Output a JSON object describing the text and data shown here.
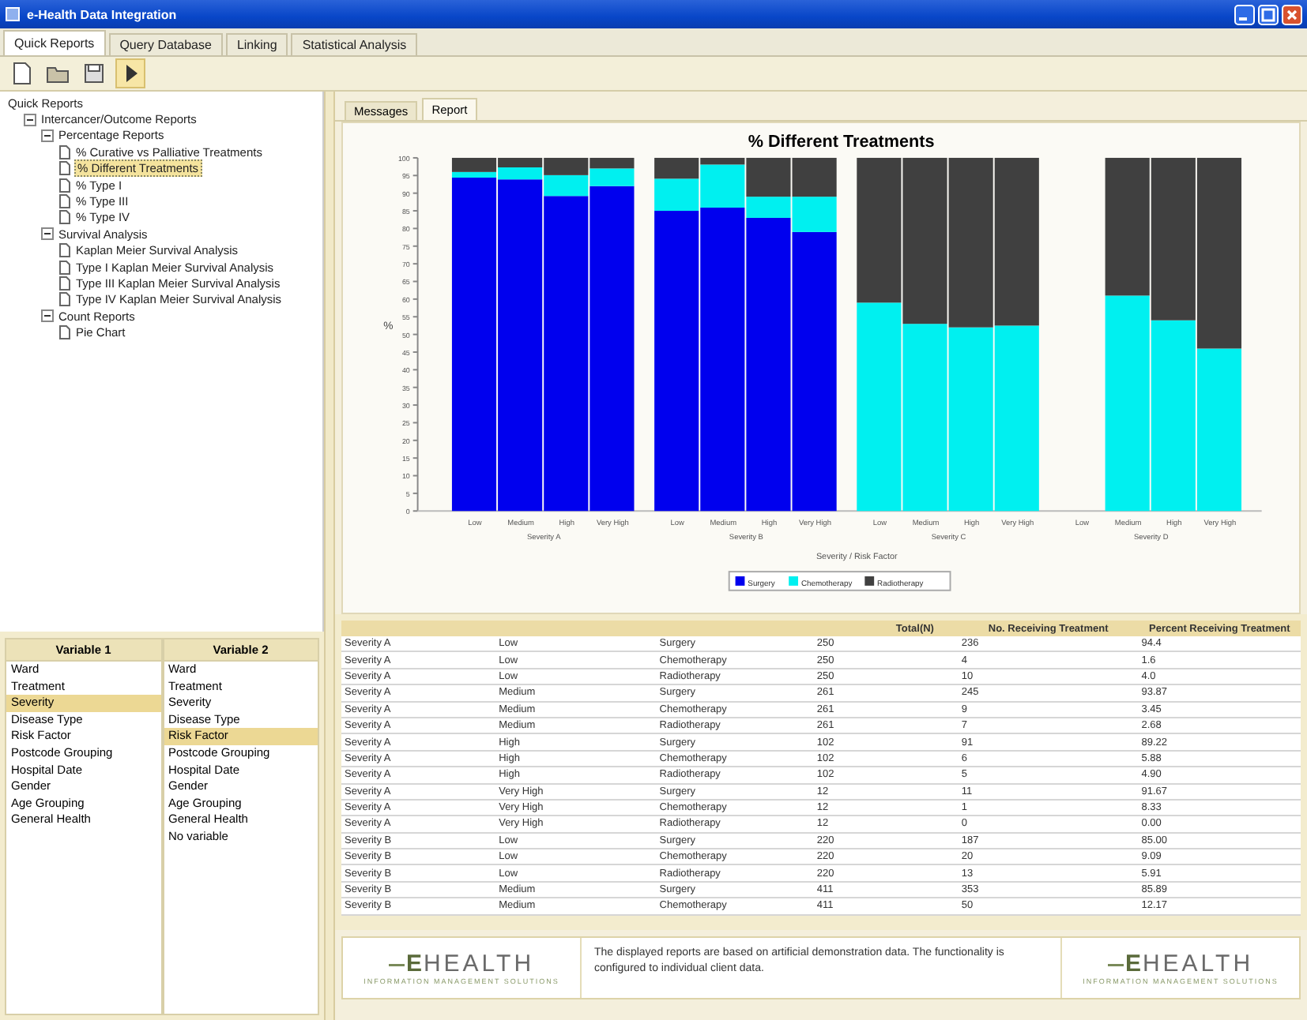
{
  "window": {
    "title": "e-Health Data Integration"
  },
  "menu_tabs": [
    {
      "label": "Quick Reports",
      "selected": true
    },
    {
      "label": "Query Database",
      "selected": false
    },
    {
      "label": "Linking",
      "selected": false
    },
    {
      "label": "Statistical Analysis",
      "selected": false
    }
  ],
  "toolbar": [
    {
      "kind": "document"
    },
    {
      "kind": "folder"
    },
    {
      "kind": "disk"
    },
    {
      "kind": "play"
    }
  ],
  "tree": {
    "items": [
      {
        "label": "Quick Reports",
        "kind": "root",
        "children": [
          {
            "label": "Intercancer/Outcome Reports",
            "kind": "folder",
            "expanded": true,
            "children": [
              {
                "label": "Percentage Reports",
                "kind": "folder",
                "expanded": true,
                "children": [
                  {
                    "label": "% Curative vs Palliative Treatments",
                    "kind": "report",
                    "selected": false
                  },
                  {
                    "label": "% Different Treatments",
                    "kind": "report",
                    "selected": true
                  },
                  {
                    "label": "% Type I",
                    "kind": "report",
                    "selected": false
                  },
                  {
                    "label": "% Type III",
                    "kind": "report",
                    "selected": false
                  },
                  {
                    "label": "% Type IV",
                    "kind": "report",
                    "selected": false
                  }
                ]
              },
              {
                "label": "Survival Analysis",
                "kind": "folder",
                "expanded": true,
                "children": [
                  {
                    "label": "Kaplan Meier Survival Analysis",
                    "kind": "report",
                    "selected": false
                  },
                  {
                    "label": "Type I Kaplan Meier Survival Analysis",
                    "kind": "report",
                    "selected": false
                  },
                  {
                    "label": "Type III Kaplan Meier Survival Analysis",
                    "kind": "report",
                    "selected": false
                  },
                  {
                    "label": "Type IV Kaplan Meier Survival Analysis",
                    "kind": "report",
                    "selected": false
                  }
                ]
              },
              {
                "label": "Count Reports",
                "kind": "folder",
                "expanded": true,
                "children": [
                  {
                    "label": "Pie Chart",
                    "kind": "report",
                    "selected": false
                  }
                ]
              }
            ]
          }
        ]
      }
    ]
  },
  "variable_lists": [
    {
      "heading": "Variable 1",
      "items": [
        {
          "label": "Ward",
          "selected": false
        },
        {
          "label": "Treatment",
          "selected": false
        },
        {
          "label": "Severity",
          "selected": true
        },
        {
          "label": "Disease Type",
          "selected": false
        },
        {
          "label": "Risk Factor",
          "selected": false
        },
        {
          "label": "Postcode Grouping",
          "selected": false
        },
        {
          "label": "Hospital Date",
          "selected": false
        },
        {
          "label": "Gender",
          "selected": false
        },
        {
          "label": "Age Grouping",
          "selected": false
        },
        {
          "label": "General Health",
          "selected": false
        }
      ]
    },
    {
      "heading": "Variable 2",
      "items": [
        {
          "label": "Ward",
          "selected": false
        },
        {
          "label": "Treatment",
          "selected": false
        },
        {
          "label": "Severity",
          "selected": false
        },
        {
          "label": "Disease Type",
          "selected": false
        },
        {
          "label": "Risk Factor",
          "selected": true
        },
        {
          "label": "Postcode Grouping",
          "selected": false
        },
        {
          "label": "Hospital Date",
          "selected": false
        },
        {
          "label": "Gender",
          "selected": false
        },
        {
          "label": "Age Grouping",
          "selected": false
        },
        {
          "label": "General Health",
          "selected": false
        },
        {
          "label": "No variable",
          "selected": false
        }
      ]
    }
  ],
  "report_tabs": [
    {
      "label": "Messages",
      "selected": false
    },
    {
      "label": "Report",
      "selected": true
    }
  ],
  "chart": {
    "group_labels": [
      "Severity A",
      "Severity B",
      "Severity C",
      "Severity D"
    ],
    "chart_data": {
      "type": "bar",
      "stacked": true,
      "title": "% Different Treatments",
      "xlabel": "Severity / Risk Factor",
      "ylabel": "%",
      "categories": [
        "Low",
        "Medium",
        "High",
        "Very High",
        "Low",
        "Medium",
        "High",
        "Very High",
        "Low",
        "Medium",
        "High",
        "Very High",
        "Low",
        "Medium",
        "High",
        "Very High"
      ],
      "ylim": [
        0,
        100
      ],
      "legend": "bottom",
      "yticks": [
        0,
        5,
        10,
        15,
        20,
        25,
        30,
        35,
        40,
        45,
        50,
        55,
        60,
        65,
        70,
        75,
        80,
        85,
        90,
        95,
        100
      ],
      "series": [
        {
          "name": "Surgery",
          "color": "#0000ee",
          "values": [
            94.4,
            93.9,
            89.2,
            92.0,
            85.0,
            85.9,
            83.0,
            79.0,
            0,
            0,
            0,
            0,
            null,
            0,
            0,
            0
          ]
        },
        {
          "name": "Chemotherapy",
          "color": "#00f0f0",
          "values": [
            1.6,
            3.4,
            5.9,
            5.0,
            9.1,
            12.2,
            6.0,
            10.0,
            59.0,
            53.0,
            52.0,
            52.5,
            null,
            61.0,
            54.0,
            46.0
          ]
        },
        {
          "name": "Radiotherapy",
          "color": "#404040",
          "values": [
            4.0,
            2.7,
            4.9,
            3.0,
            5.9,
            1.9,
            11.0,
            11.0,
            41.0,
            47.0,
            48.0,
            47.5,
            null,
            39.0,
            46.0,
            54.0
          ]
        }
      ]
    }
  },
  "table": {
    "column_headings": [
      "Total(N)",
      "No. Receiving Treatment",
      "Percent Receiving Treatment"
    ],
    "rows": [
      [
        "Severity A",
        "Low",
        "Surgery",
        "250",
        "236",
        "94.4"
      ],
      [
        "Severity A",
        "Low",
        "Chemotherapy",
        "250",
        "4",
        "1.6"
      ],
      [
        "Severity A",
        "Low",
        "Radiotherapy",
        "250",
        "10",
        "4.0"
      ],
      [
        "Severity A",
        "Medium",
        "Surgery",
        "261",
        "245",
        "93.87"
      ],
      [
        "Severity A",
        "Medium",
        "Chemotherapy",
        "261",
        "9",
        "3.45"
      ],
      [
        "Severity A",
        "Medium",
        "Radiotherapy",
        "261",
        "7",
        "2.68"
      ],
      [
        "Severity A",
        "High",
        "Surgery",
        "102",
        "91",
        "89.22"
      ],
      [
        "Severity A",
        "High",
        "Chemotherapy",
        "102",
        "6",
        "5.88"
      ],
      [
        "Severity A",
        "High",
        "Radiotherapy",
        "102",
        "5",
        "4.90"
      ],
      [
        "Severity A",
        "Very High",
        "Surgery",
        "12",
        "11",
        "91.67"
      ],
      [
        "Severity A",
        "Very High",
        "Chemotherapy",
        "12",
        "1",
        "8.33"
      ],
      [
        "Severity A",
        "Very High",
        "Radiotherapy",
        "12",
        "0",
        "0.00"
      ],
      [
        "Severity B",
        "Low",
        "Surgery",
        "220",
        "187",
        "85.00"
      ],
      [
        "Severity B",
        "Low",
        "Chemotherapy",
        "220",
        "20",
        "9.09"
      ],
      [
        "Severity B",
        "Low",
        "Radiotherapy",
        "220",
        "13",
        "5.91"
      ],
      [
        "Severity B",
        "Medium",
        "Surgery",
        "411",
        "353",
        "85.89"
      ],
      [
        "Severity B",
        "Medium",
        "Chemotherapy",
        "411",
        "50",
        "12.17"
      ]
    ]
  },
  "footer": {
    "logos": [
      {
        "prefix": "E",
        "name": "HEALTH",
        "tagline": "INFORMATION MANAGEMENT SOLUTIONS"
      },
      {
        "prefix": "E",
        "name": "HEALTH",
        "tagline": "INFORMATION MANAGEMENT SOLUTIONS"
      }
    ],
    "notice": "The displayed reports are based on artificial demonstration data. The functionality is configured to individual client data."
  }
}
